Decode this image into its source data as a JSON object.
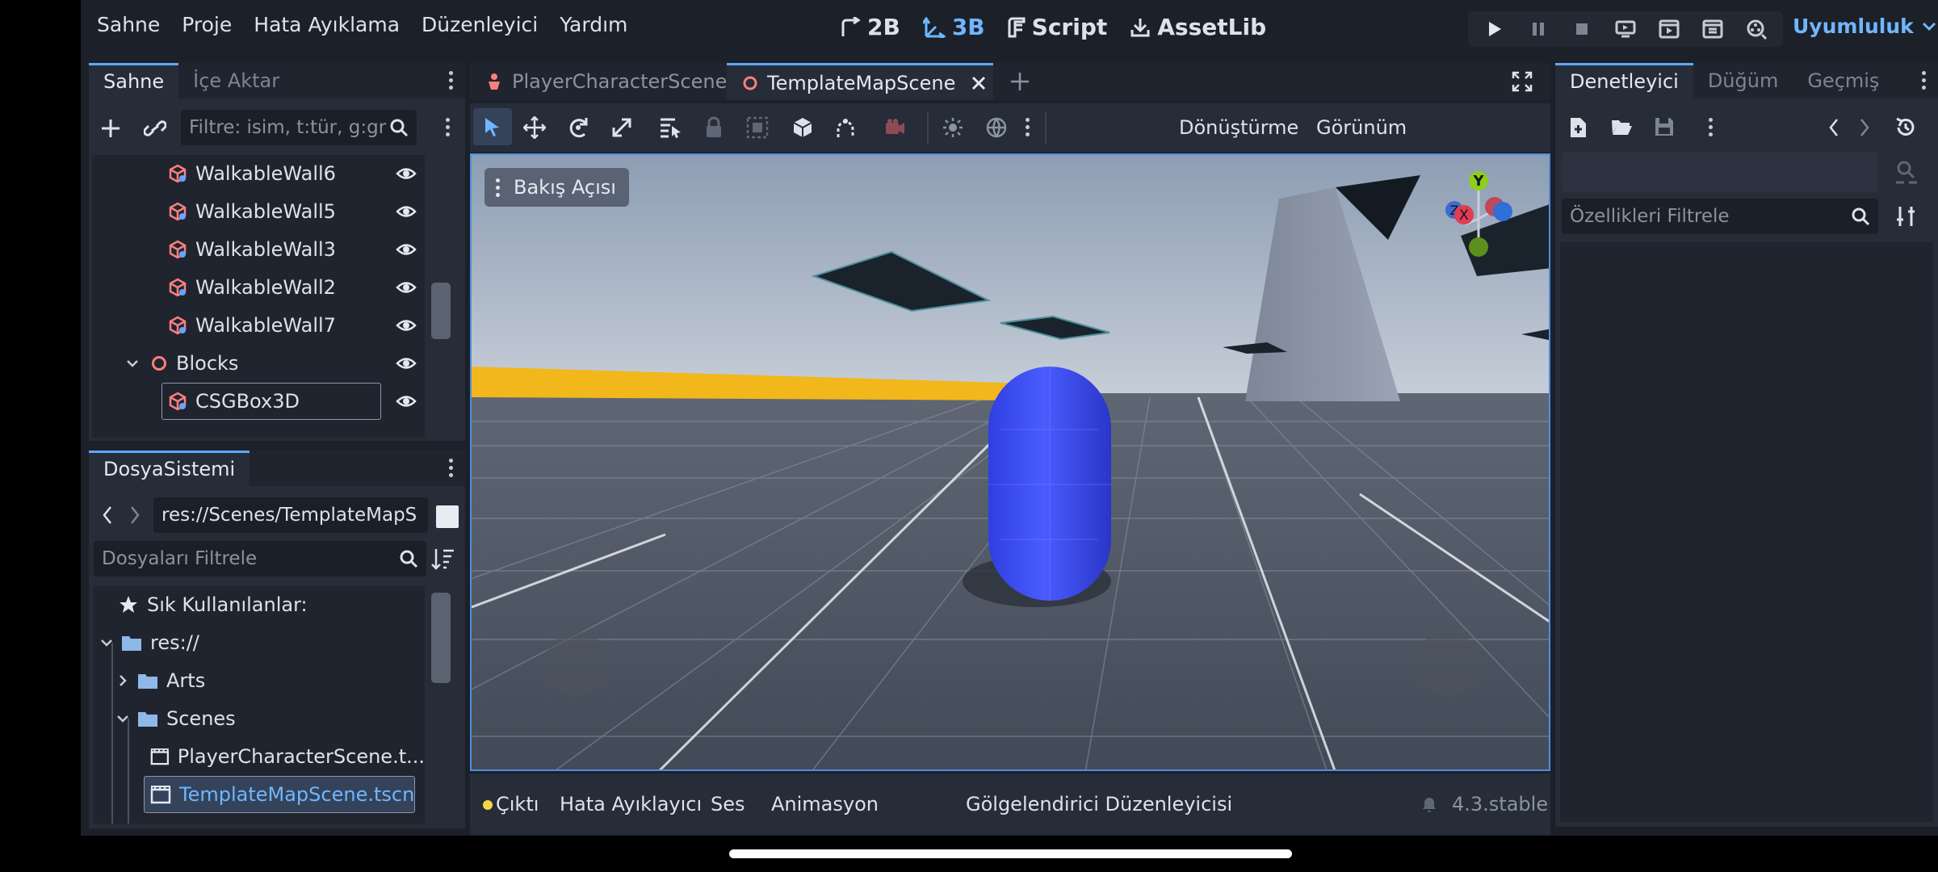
{
  "menu": [
    "Sahne",
    "Proje",
    "Hata Ayıklama",
    "Düzenleyici",
    "Yardım"
  ],
  "modes": [
    {
      "label": "2B",
      "icon": "2d-icon",
      "active": false
    },
    {
      "label": "3B",
      "icon": "3d-icon",
      "active": true
    },
    {
      "label": "Script",
      "icon": "script-icon",
      "active": false
    },
    {
      "label": "AssetLib",
      "icon": "assetlib-icon",
      "active": false
    }
  ],
  "renderer": "Uyumluluk",
  "scene_dock": {
    "tabs": [
      "Sahne",
      "İçe Aktar"
    ],
    "filter_placeholder": "Filtre: isim, t:tür, g:gr",
    "nodes": [
      {
        "label": "WalkableWall6",
        "indent": 2,
        "type": "csg"
      },
      {
        "label": "WalkableWall5",
        "indent": 2,
        "type": "csg"
      },
      {
        "label": "WalkableWall3",
        "indent": 2,
        "type": "csg"
      },
      {
        "label": "WalkableWall2",
        "indent": 2,
        "type": "csg"
      },
      {
        "label": "WalkableWall7",
        "indent": 2,
        "type": "csg"
      },
      {
        "label": "Blocks",
        "indent": 1,
        "type": "node3d",
        "expanded": true
      },
      {
        "label": "CSGBox3D",
        "indent": 2,
        "type": "csg",
        "selected": true
      }
    ]
  },
  "filesystem": {
    "tab": "DosyaSistemi",
    "path": "res://Scenes/TemplateMapS",
    "filter_placeholder": "Dosyaları Filtrele",
    "items": [
      {
        "label": "Sık Kullanılanlar:",
        "type": "star"
      },
      {
        "label": "res://",
        "type": "folder",
        "expanded": true
      },
      {
        "label": "Arts",
        "type": "folder",
        "expanded": false
      },
      {
        "label": "Scenes",
        "type": "folder",
        "expanded": true
      },
      {
        "label": "PlayerCharacterScene.t...",
        "type": "scene"
      },
      {
        "label": "TemplateMapScene.tscn",
        "type": "scene",
        "selected": true
      }
    ]
  },
  "editor_tabs": [
    {
      "label": "PlayerCharacterScene",
      "active": false
    },
    {
      "label": "TemplateMapScene",
      "active": true
    }
  ],
  "toolbar": {
    "transform_menu": "Dönüştürme",
    "view_menu": "Görünüm"
  },
  "viewport": {
    "view_label": "Bakış Açısı"
  },
  "gizmo": {
    "y": "Y",
    "x": "X",
    "z": "Z"
  },
  "bottom_tabs": [
    "Çıktı",
    "Hata Ayıklayıcı",
    "Ses",
    "Animasyon",
    "Gölgelendirici Düzenleyicisi"
  ],
  "version": "4.3.stable",
  "inspector": {
    "tabs": [
      "Denetleyici",
      "Düğüm",
      "Geçmiş"
    ],
    "filter_placeholder": "Özellikleri Filtrele"
  },
  "colors": {
    "accent": "#70b6ff",
    "node_icon": "#fc7f7f",
    "folder": "#8fb8e8"
  }
}
